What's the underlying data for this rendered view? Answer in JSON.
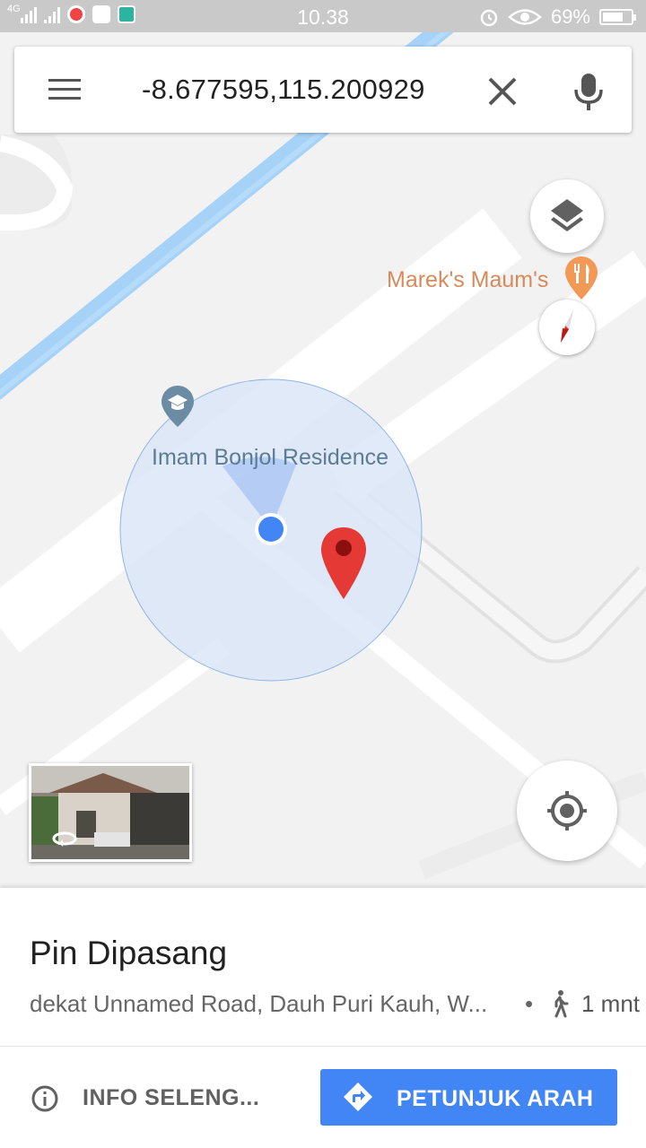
{
  "status_bar": {
    "network": "4G",
    "time": "10.38",
    "battery": "69%",
    "battery_level": 0.69
  },
  "search": {
    "query": "-8.677595,115.200929",
    "icons": [
      "menu-icon",
      "close-icon",
      "mic-icon"
    ]
  },
  "map": {
    "places": [
      {
        "name": "Marek's Maum's",
        "icon": "restaurant-icon",
        "color": "#f29a55"
      },
      {
        "name": "Imam Bonjol Residence",
        "icon": "school-icon",
        "color": "#6b8ca3"
      }
    ],
    "colors": {
      "water": "#a7d2f7",
      "accuracy_circle": "#dce7f7",
      "my_location": "#4285f4",
      "pin": "#e53935"
    },
    "controls": [
      "layers-icon",
      "compass-icon",
      "my-location-icon",
      "street-view-thumbnail"
    ]
  },
  "sheet": {
    "title": "Pin Dipasang",
    "subtitle": "dekat Unnamed Road, Dauh Puri Kauh, W...",
    "separator": "•",
    "walk_time": "1 mnt",
    "more_info": "INFO SELENG...",
    "directions": "PETUNJUK ARAH"
  }
}
